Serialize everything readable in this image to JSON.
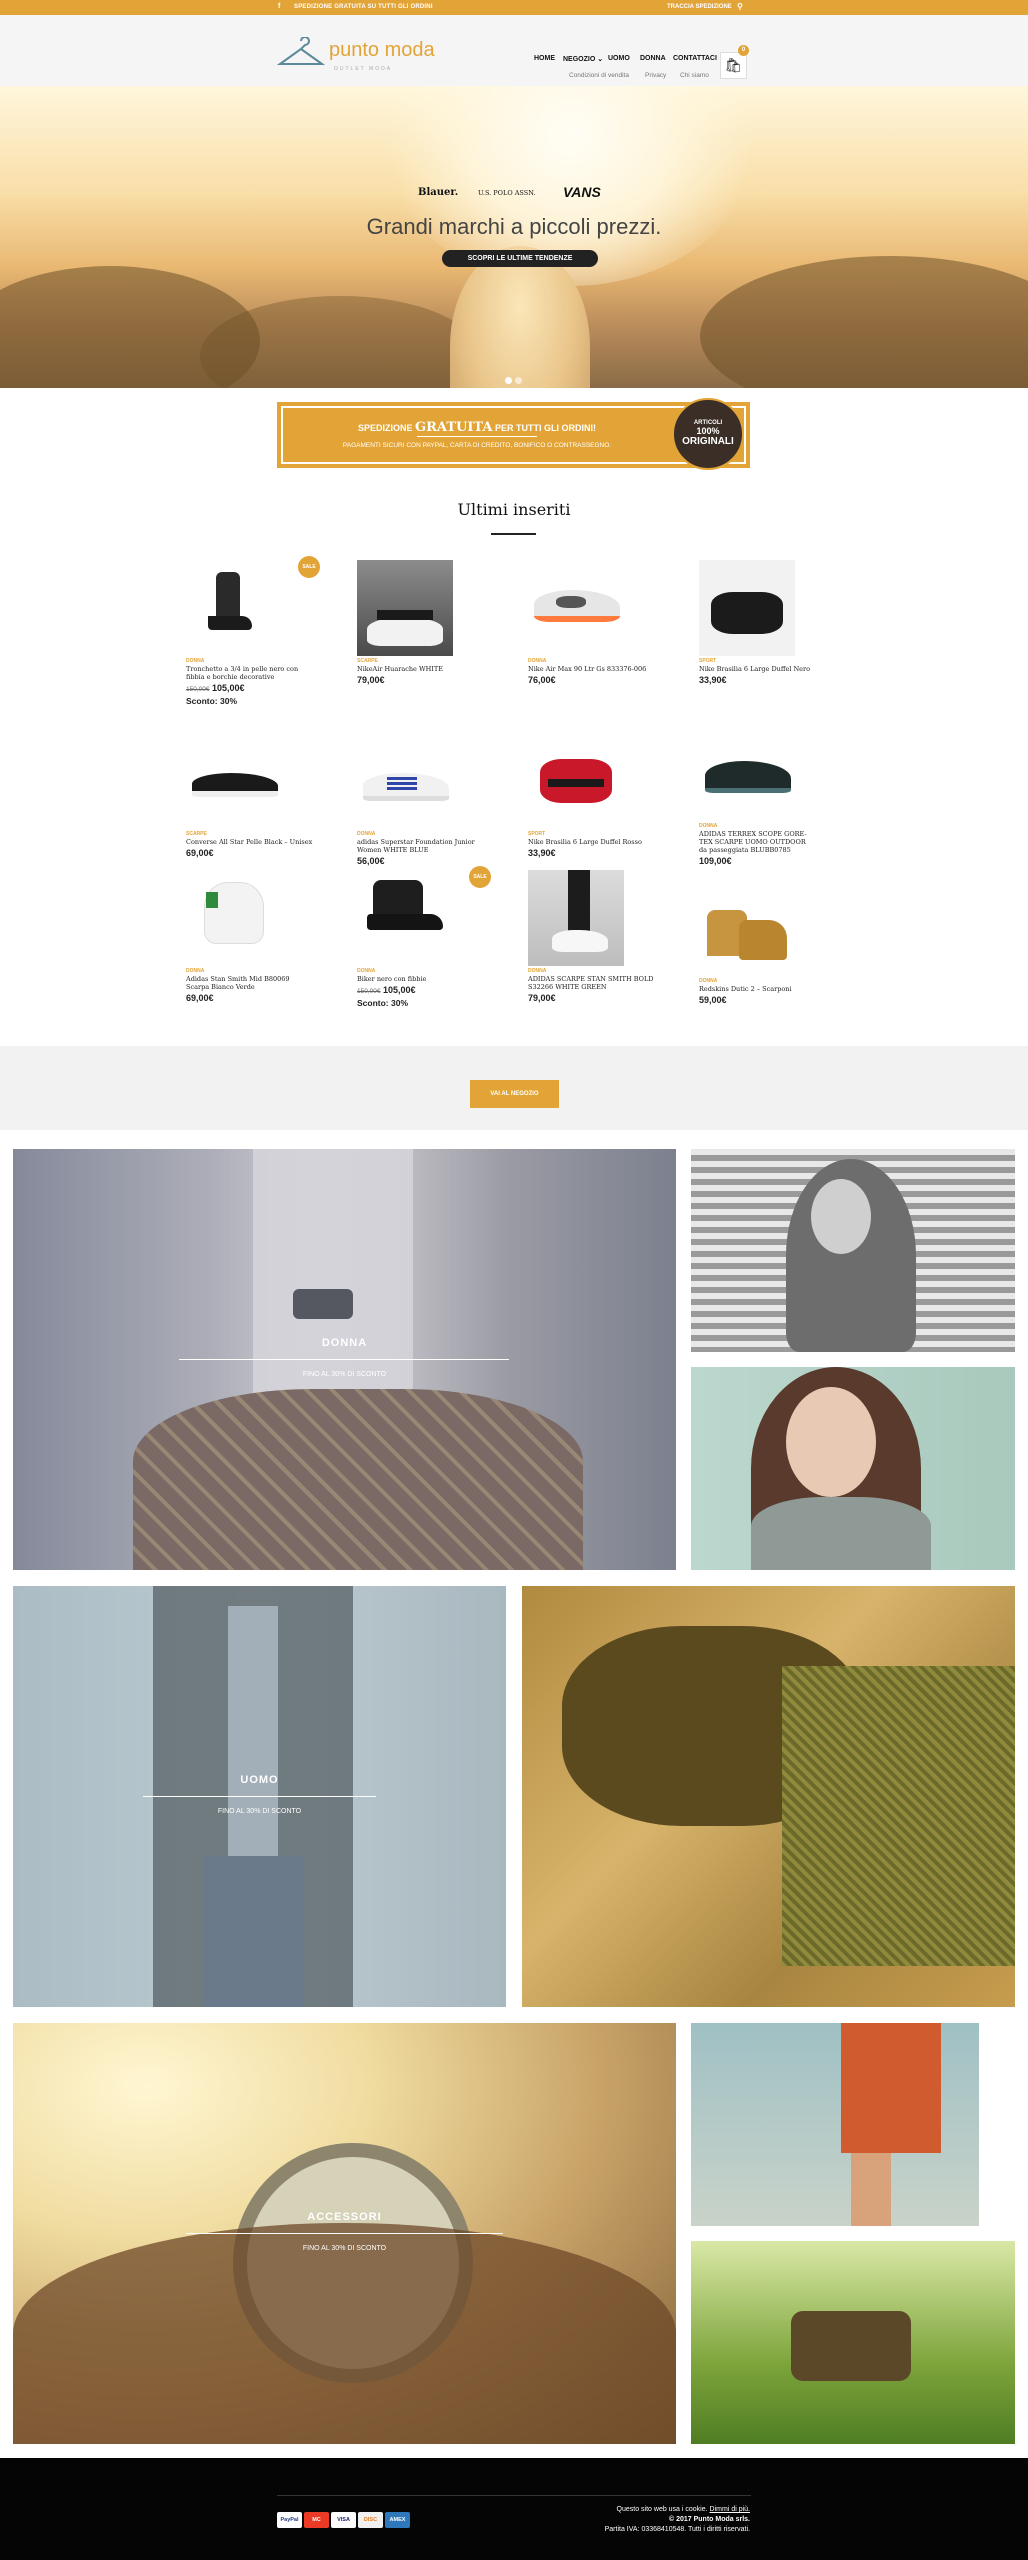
{
  "topbar": {
    "shipping": "SPEDIZIONE GRATUITA SU TUTTI GLI ORDINI",
    "track": "TRACCIA SPEDIZIONE"
  },
  "logo": {
    "name": "punto moda",
    "tagline": "OUTLET MODA"
  },
  "nav": {
    "items": [
      "HOME",
      "NEGOZIO",
      "UOMO",
      "DONNA",
      "CONTATTACI"
    ],
    "sub": [
      "Condizioni di vendita",
      "Privacy",
      "Chi siamo"
    ]
  },
  "cart": {
    "count": "0"
  },
  "hero": {
    "brands": [
      "Blauer.",
      "U.S. POLO ASSN.",
      "VANS"
    ],
    "title": "Grandi marchi a piccoli prezzi.",
    "button": "SCOPRI LE ULTIME TENDENZE"
  },
  "banner": {
    "line1a": "SPEDIZIONE ",
    "line1b": "GRATUITA",
    "line1c": " PER TUTTI GLI ORDINI!",
    "line2": "PAGAMENTI SICURI CON PAYPAL, CARTA DI CREDITO, BONIFICO O CONTRASSEGNO.",
    "badge_a": "ARTICOLI",
    "badge_b": "100%",
    "badge_c": "ORIGINALI"
  },
  "section_title": "Ultimi inseriti",
  "products": [
    {
      "cat": "DONNA",
      "name": "Tronchetto a 3/4 in pelle nero con fibbia e borchie decorative",
      "old": "150,00€",
      "price": "105,00€",
      "disc": "Sconto: 30%",
      "sale": "SALE"
    },
    {
      "cat": "SCARPE",
      "name": "NikeAir Huarache WHITE",
      "price": "79,00€"
    },
    {
      "cat": "DONNA",
      "name": "Nike Air Max 90 Ltr Gs 833376-006",
      "price": "76,00€"
    },
    {
      "cat": "SPORT",
      "name": "Nike Brasilia 6 Large Duffel Nero",
      "price": "33,90€"
    },
    {
      "cat": "SCARPE",
      "name": "Converse All Star Pelle Black – Unisex",
      "price": "69,00€"
    },
    {
      "cat": "DONNA",
      "name": "adidas Superstar Foundation Junior Women WHITE BLUE",
      "price": "56,00€"
    },
    {
      "cat": "SPORT",
      "name": "Nike Brasilia 6 Large Duffel Rosso",
      "price": "33,90€"
    },
    {
      "cat": "DONNA",
      "name": "ADIDAS TERREX SCOPE GORE-TEX SCARPE UOMO OUTDOOR da passeggiata BLUBB0785",
      "price": "109,00€"
    },
    {
      "cat": "DONNA",
      "name": "Adidas Stan Smith Mid B80069 Scarpa Bianco Verde",
      "price": "69,00€"
    },
    {
      "cat": "DONNA",
      "name": "Biker nero con fibbie",
      "old": "150,00€",
      "price": "105,00€",
      "disc": "Sconto: 30%",
      "sale": "SALE"
    },
    {
      "cat": "DONNA",
      "name": "ADIDAS SCARPE STAN SMITH BOLD S32266 WHITE GREEN",
      "price": "79,00€"
    },
    {
      "cat": "DONNA",
      "name": "Redskins Dutic 2 – Scarponi",
      "price": "59,00€"
    }
  ],
  "shop_button": "VAI AL NEGOZIO",
  "tiles": {
    "donna": {
      "label": "DONNA",
      "sub": "FINO AL 30% DI SCONTO"
    },
    "uomo": {
      "label": "UOMO",
      "sub": "FINO AL 30% DI SCONTO"
    },
    "accessori": {
      "label": "ACCESSORI",
      "sub": "FINO AL 30% DI SCONTO"
    }
  },
  "footer": {
    "cards": [
      "PayPal",
      "MC",
      "VISA",
      "DISC",
      "AMEX"
    ],
    "cookie": "Questo sito web usa i cookie.",
    "cookie_link": "Dimmi di più.",
    "copy": "© 2017 Punto Moda srls.",
    "vat": "Partita IVA: 03368410548. Tutti i diritti riservati."
  },
  "colors": {
    "accent": "#e3a437",
    "dark": "#050505"
  }
}
